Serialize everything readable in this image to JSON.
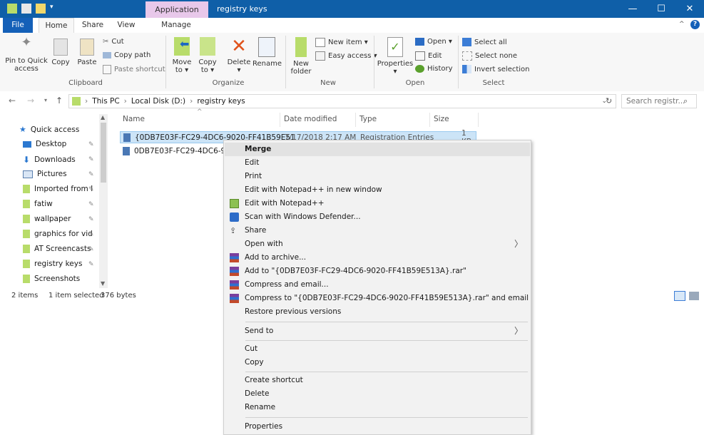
{
  "titlebar": {
    "context_tab": "Application Tools",
    "title": "registry keys",
    "minimize": "—",
    "maximize": "☐",
    "close": "✕"
  },
  "tabs": {
    "file": "File",
    "home": "Home",
    "share": "Share",
    "view": "View",
    "manage": "Manage"
  },
  "ribbon": {
    "pin_label1": "Pin to Quick",
    "pin_label2": "access",
    "copy": "Copy",
    "paste": "Paste",
    "cut": "Cut",
    "copy_path": "Copy path",
    "paste_shortcut": "Paste shortcut",
    "clipboard_group": "Clipboard",
    "move_to1": "Move",
    "move_to2": "to ▾",
    "copy_to1": "Copy",
    "copy_to2": "to ▾",
    "delete": "Delete",
    "delete_arrow": "▾",
    "rename": "Rename",
    "organize_group": "Organize",
    "new_folder1": "New",
    "new_folder2": "folder",
    "new_item": "New item ▾",
    "easy_access": "Easy access ▾",
    "new_group": "New",
    "properties": "Properties",
    "properties_arrow": "▾",
    "open": "Open ▾",
    "edit": "Edit",
    "history": "History",
    "open_group": "Open",
    "select_all": "Select all",
    "select_none": "Select none",
    "invert_selection": "Invert selection",
    "select_group": "Select"
  },
  "address": {
    "crumbs": [
      "This PC",
      "Local Disk (D:)",
      "registry keys"
    ],
    "search_placeholder": "Search registr..."
  },
  "nav": {
    "items": [
      {
        "label": "Quick access"
      },
      {
        "label": "Desktop"
      },
      {
        "label": "Downloads"
      },
      {
        "label": "Pictures"
      },
      {
        "label": "Imported from I"
      },
      {
        "label": "fatiw"
      },
      {
        "label": "wallpaper"
      },
      {
        "label": "graphics for vid"
      },
      {
        "label": "AT Screencasts"
      },
      {
        "label": "registry keys"
      },
      {
        "label": "Screenshots"
      }
    ]
  },
  "files": {
    "columns": [
      "Name",
      "Date modified",
      "Type",
      "Size"
    ],
    "rows": [
      {
        "name": "{0DB7E03F-FC29-4DC6-9020-FF41B59E51",
        "date": "7/17/2018 2:17 AM",
        "type": "Registration Entries",
        "size": "1 KB"
      },
      {
        "name": "0DB7E03F-FC29-4DC6-9020",
        "date": "",
        "type": "",
        "size": ""
      }
    ]
  },
  "status": {
    "items": "2 items",
    "selected": "1 item selected",
    "size": "376 bytes"
  },
  "menu": {
    "merge": "Merge",
    "edit": "Edit",
    "print": "Print",
    "edit_npp_new": "Edit with Notepad++ in new window",
    "edit_npp": "Edit with Notepad++",
    "scan_defender": "Scan with Windows Defender...",
    "share": "Share",
    "open_with": "Open with",
    "add_archive": "Add to archive...",
    "add_to_rar": "Add to \"{0DB7E03F-FC29-4DC6-9020-FF41B59E513A}.rar\"",
    "compress_email": "Compress and email...",
    "compress_rar_email": "Compress to \"{0DB7E03F-FC29-4DC6-9020-FF41B59E513A}.rar\" and email",
    "restore_versions": "Restore previous versions",
    "send_to": "Send to",
    "cut": "Cut",
    "copy": "Copy",
    "create_shortcut": "Create shortcut",
    "delete": "Delete",
    "rename": "Rename",
    "properties": "Properties",
    "submenu_arrow": "〉"
  },
  "colors": {
    "titlebar": "#0f5fa8",
    "context_tab": "#e8c8ea",
    "selection": "#cce4f7",
    "menu_bg": "#f2f2f2"
  }
}
